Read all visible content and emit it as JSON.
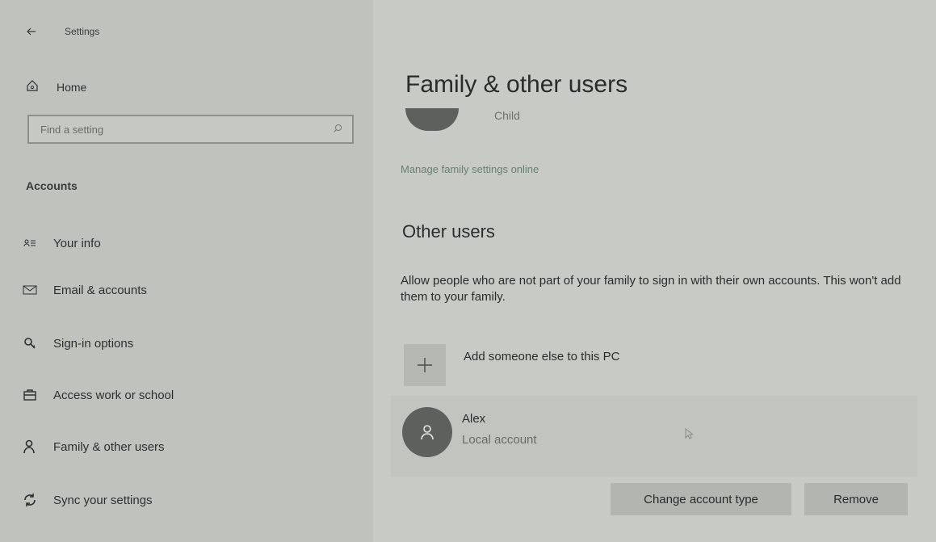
{
  "window": {
    "title": "Settings",
    "back_icon": "back-arrow-icon"
  },
  "sidebar": {
    "home_label": "Home",
    "home_icon": "home-icon",
    "search_placeholder": "Find a setting",
    "search_icon": "search-icon",
    "section_label": "Accounts",
    "items": [
      {
        "label": "Your info",
        "icon": "contact-card-icon"
      },
      {
        "label": "Email & accounts",
        "icon": "mail-icon"
      },
      {
        "label": "Sign-in options",
        "icon": "key-icon"
      },
      {
        "label": "Access work or school",
        "icon": "briefcase-icon"
      },
      {
        "label": "Family & other users",
        "icon": "person-icon"
      },
      {
        "label": "Sync your settings",
        "icon": "sync-icon"
      }
    ]
  },
  "main": {
    "title": "Family & other users",
    "child_label": "Child",
    "manage_link": "Manage family settings online",
    "other_users_heading": "Other users",
    "description": "Allow people who are not part of your family to sign in with their own accounts. This won't add them to your family.",
    "add_label": "Add someone else to this PC",
    "add_icon": "plus-icon",
    "user": {
      "name": "Alex",
      "type": "Local account",
      "avatar_icon": "person-icon"
    },
    "change_button": "Change account type",
    "remove_button": "Remove"
  }
}
